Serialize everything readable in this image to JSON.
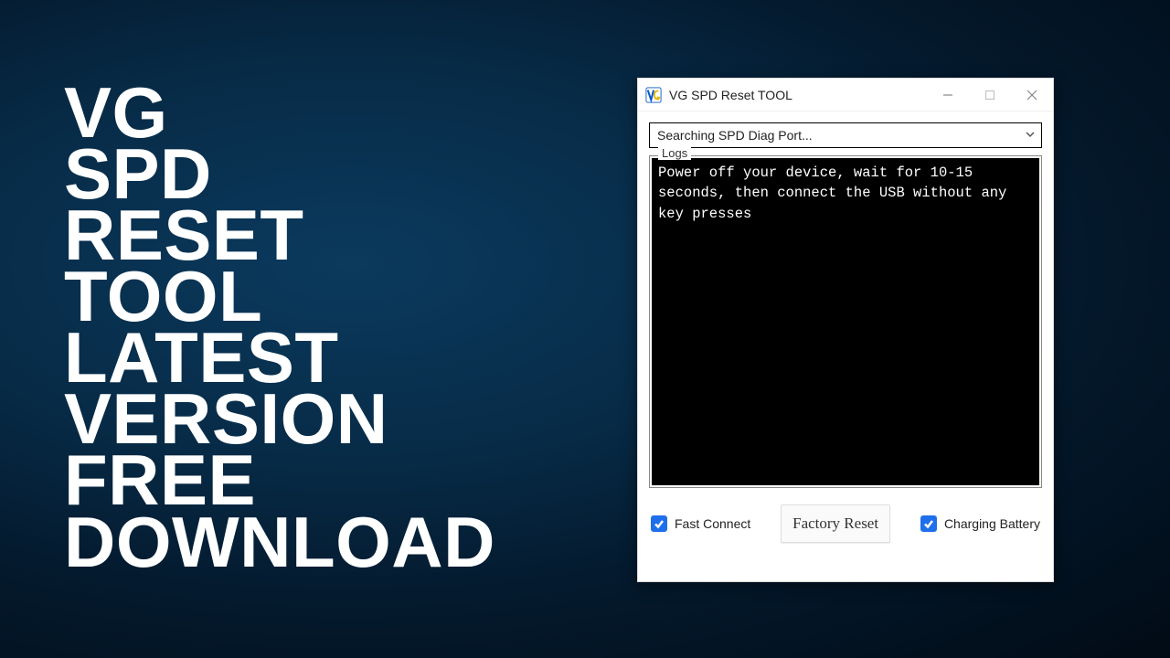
{
  "headline": {
    "lines": [
      "VG",
      "SPD",
      "RESET",
      "TOOL",
      "LATEST",
      "VERSION",
      "FREE",
      "DOWNLOAD"
    ]
  },
  "window": {
    "title": "VG SPD Reset TOOL"
  },
  "dropdown": {
    "selected": "Searching SPD Diag Port..."
  },
  "logs": {
    "legend": "Logs",
    "text": "Power off your device, wait for 10-15 seconds, then connect the USB without any key presses"
  },
  "footer": {
    "fast_connect_label": "Fast Connect",
    "fast_connect_checked": true,
    "factory_reset_label": "Factory Reset",
    "charging_battery_label": "Charging Battery",
    "charging_battery_checked": true
  },
  "colors": {
    "checkbox_accent": "#1f6feb"
  }
}
